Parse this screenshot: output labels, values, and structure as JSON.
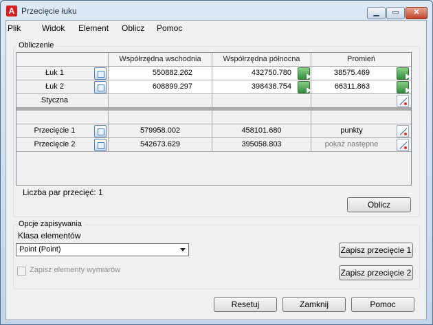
{
  "window": {
    "title": "Przecięcie łuku",
    "app_icon": "A"
  },
  "window_controls": {
    "minimize": "▁",
    "maximize": "▭",
    "close": "✕"
  },
  "menu": {
    "items": [
      "Plik",
      "Widok",
      "Element",
      "Oblicz",
      "Pomoc"
    ]
  },
  "calculation": {
    "group_title": "Obliczenie",
    "columns": [
      "Współrzędna wschodnia",
      "Współrzędna północna",
      "Promień"
    ],
    "rows": [
      {
        "label": "Łuk 1",
        "east": "550882.262",
        "north": "432750.780",
        "radius": "38575.469"
      },
      {
        "label": "Łuk 2",
        "east": "608899.297",
        "north": "398438.754",
        "radius": "66311.863"
      },
      {
        "label": "Styczna"
      },
      {
        "label": "Przecięcie 1",
        "east": "579958.002",
        "north": "458101.680",
        "radius": "punkty"
      },
      {
        "label": "Przecięcie 2",
        "east": "542673.629",
        "north": "395058.803",
        "radius": "pokaż następne"
      }
    ],
    "pair_count_text": "Liczba par przecięć: 1",
    "calculate_button": "Oblicz"
  },
  "save_options": {
    "group_title": "Opcje zapisywania",
    "class_label": "Klasa elementów",
    "class_value": "Point (Point)",
    "save_dimensions_label": "Zapisz elementy wymiarów",
    "save_dimensions_checked": false,
    "save_intersection_1": "Zapisz przecięcie 1",
    "save_intersection_2": "Zapisz przecięcie 2"
  },
  "footer": {
    "reset": "Resetuj",
    "close": "Zamknij",
    "help": "Pomoc"
  }
}
